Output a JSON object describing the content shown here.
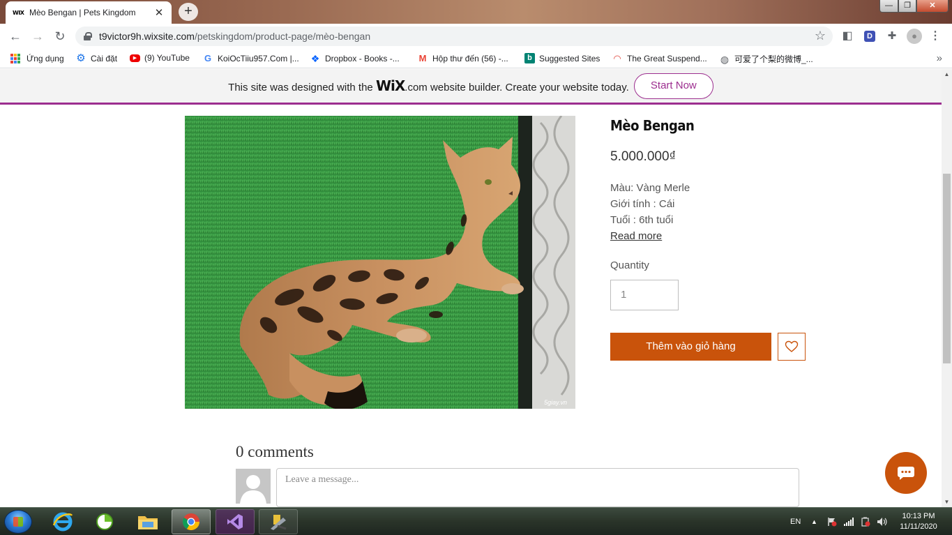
{
  "browser": {
    "tab_favicon": "WIX",
    "tab_title": "Mèo Bengan | Pets Kingdom",
    "url_host": "t9victor9h.wixsite.com",
    "url_path": "/petskingdom/product-page/mèo-bengan",
    "ext_d_label": "D"
  },
  "bookmarks": [
    {
      "label": "Ứng dụng",
      "icon": "apps-grid-icon"
    },
    {
      "label": "Cài đặt",
      "icon": "gear-icon"
    },
    {
      "label": "(9) YouTube",
      "icon": "youtube-icon"
    },
    {
      "label": "KoiOcTiiu957.Com |...",
      "icon": "google-icon"
    },
    {
      "label": "Dropbox - Books -...",
      "icon": "dropbox-icon"
    },
    {
      "label": "Hộp thư đến (56) -...",
      "icon": "gmail-icon"
    },
    {
      "label": "Suggested Sites",
      "icon": "bing-icon"
    },
    {
      "label": "The Great Suspend...",
      "icon": "rainbow-icon"
    },
    {
      "label": "可爱了个梨的微博_...",
      "icon": "globe-icon"
    }
  ],
  "wix_banner": {
    "text_before": "This site was designed with the",
    "logo": "WiX",
    "text_after": ".com website builder. Create your website today.",
    "cta": "Start Now"
  },
  "product": {
    "title": "Mèo Bengan",
    "price": "5.000.000₫",
    "desc_lines": [
      "Màu: Vàng Merle",
      "Giới tính : Cái",
      "Tuổi : 6th tuổi"
    ],
    "read_more": "Read more",
    "quantity_label": "Quantity",
    "quantity_value": "1",
    "add_to_cart": "Thêm vào giỏ hàng",
    "image_watermark": "5giay.vn"
  },
  "comments": {
    "title": "0 comments",
    "placeholder": "Leave a message..."
  },
  "taskbar": {
    "language": "EN",
    "time": "10:13 PM",
    "date": "11/11/2020"
  },
  "colors": {
    "accent": "#c9530b",
    "wix_purple": "#9c2e8f"
  }
}
